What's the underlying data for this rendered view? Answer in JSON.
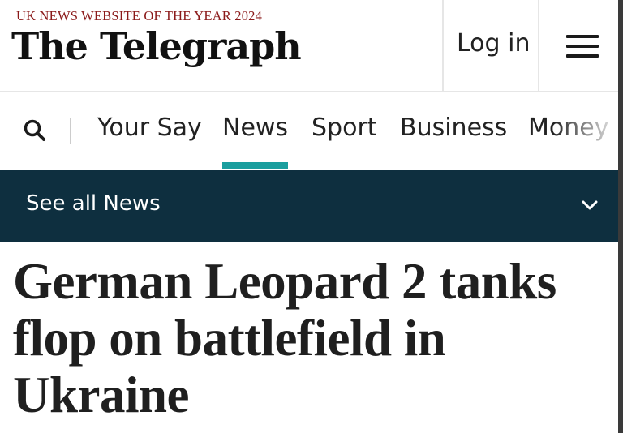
{
  "masthead": {
    "award_text": "UK NEWS WEBSITE OF THE YEAR 2024",
    "logo_text": "The Telegraph",
    "login_label": "Log in",
    "menu_icon": "hamburger-menu-icon"
  },
  "nav": {
    "search_icon": "search-icon",
    "items": [
      {
        "label": "Your Say",
        "active": false
      },
      {
        "label": "News",
        "active": true
      },
      {
        "label": "Sport",
        "active": false
      },
      {
        "label": "Business",
        "active": false
      },
      {
        "label": "Money",
        "active": false
      }
    ],
    "active_color": "#1a9e9e"
  },
  "subnav": {
    "label": "See all News",
    "icon": "chevron-down-icon",
    "background": "#0e2f3f"
  },
  "article": {
    "headline": "German Leopard 2 tanks flop on battlefield in Ukraine"
  },
  "colors": {
    "award": "#8b1a1a",
    "text": "#1f1f1f",
    "subnav_bg": "#0e2f3f",
    "accent": "#1a9e9e"
  }
}
